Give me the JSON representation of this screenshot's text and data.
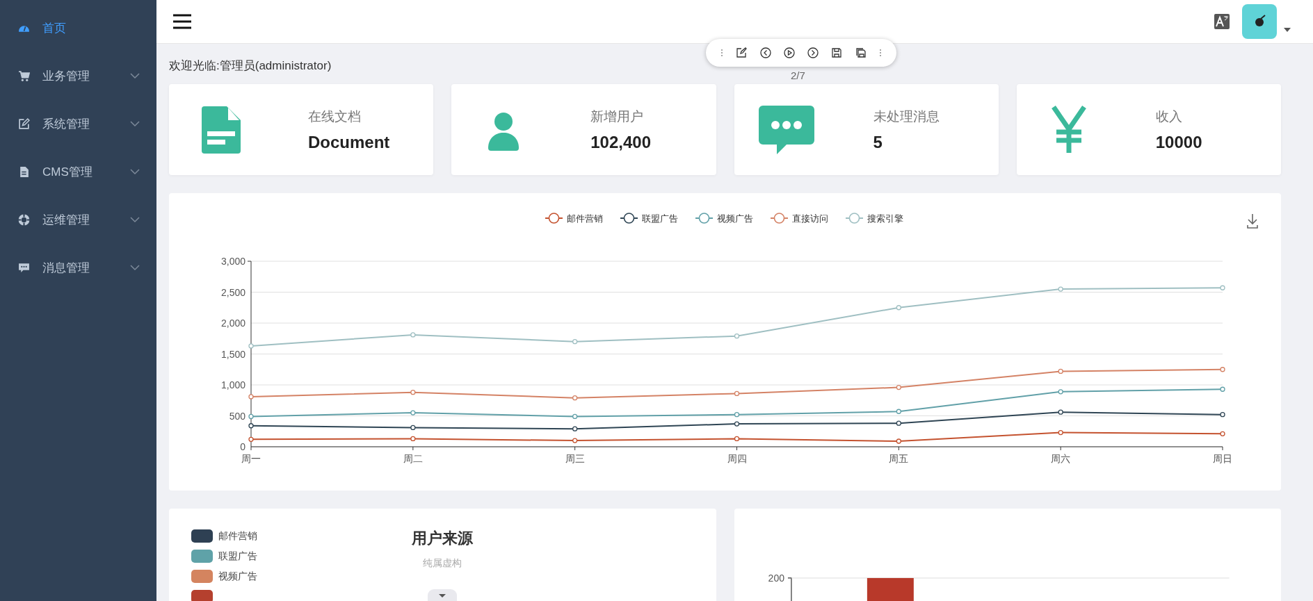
{
  "sidebar": {
    "items": [
      {
        "label": "首页",
        "selected": true,
        "expandable": false
      },
      {
        "label": "业务管理",
        "selected": false,
        "expandable": true
      },
      {
        "label": "系统管理",
        "selected": false,
        "expandable": true
      },
      {
        "label": "CMS管理",
        "selected": false,
        "expandable": true
      },
      {
        "label": "运维管理",
        "selected": false,
        "expandable": true
      },
      {
        "label": "消息管理",
        "selected": false,
        "expandable": true
      }
    ]
  },
  "viewer_toolbar": {
    "page": "2/7"
  },
  "welcome": "欢迎光临:管理员(administrator)",
  "stats": [
    {
      "kind": "document",
      "label": "在线文档",
      "value": "Document"
    },
    {
      "kind": "user",
      "label": "新增用户",
      "value": "102,400"
    },
    {
      "kind": "message",
      "label": "未处理消息",
      "value": "5"
    },
    {
      "kind": "money",
      "label": "收入",
      "value": "10000"
    }
  ],
  "line_card": {
    "chart_data": {
      "type": "line",
      "grid": true,
      "legend": "top",
      "categories": [
        "周一",
        "周二",
        "周三",
        "周四",
        "周五",
        "周六",
        "周日"
      ],
      "ylim": [
        0,
        3000
      ],
      "yticks": [
        {
          "value": 0,
          "label": "0"
        },
        {
          "value": 500,
          "label": "500"
        },
        {
          "value": 1000,
          "label": "1,000"
        },
        {
          "value": 1500,
          "label": "1,500"
        },
        {
          "value": 2000,
          "label": "2,000"
        },
        {
          "value": 2500,
          "label": "2,500"
        },
        {
          "value": 3000,
          "label": "3,000"
        }
      ],
      "series": [
        {
          "name": "邮件营销",
          "color": "#c4522f",
          "marker": "circle",
          "values": [
            120,
            130,
            100,
            130,
            90,
            230,
            210
          ]
        },
        {
          "name": "联盟广告",
          "color": "#2f4554",
          "marker": "circle",
          "values": [
            340,
            310,
            290,
            370,
            380,
            560,
            520
          ]
        },
        {
          "name": "视频广告",
          "color": "#61a0a8",
          "marker": "circle",
          "values": [
            490,
            550,
            490,
            520,
            570,
            890,
            930
          ]
        },
        {
          "name": "直接访问",
          "color": "#d48265",
          "marker": "circle",
          "values": [
            810,
            880,
            790,
            860,
            960,
            1220,
            1250
          ]
        },
        {
          "name": "搜索引擎",
          "color": "#9fbfc2",
          "marker": "circle",
          "values": [
            1630,
            1810,
            1700,
            1790,
            2250,
            2550,
            2570
          ]
        }
      ]
    }
  },
  "source_card": {
    "title": "用户来源",
    "subtitle": "纯属虚构",
    "legend": [
      {
        "label": "邮件营销",
        "color": "#2e4053"
      },
      {
        "label": "联盟广告",
        "color": "#5fa2a8"
      },
      {
        "label": "视频广告",
        "color": "#d4845f"
      },
      {
        "color": "#b5402e"
      }
    ]
  },
  "bar_card": {
    "ytick_label": "200"
  }
}
